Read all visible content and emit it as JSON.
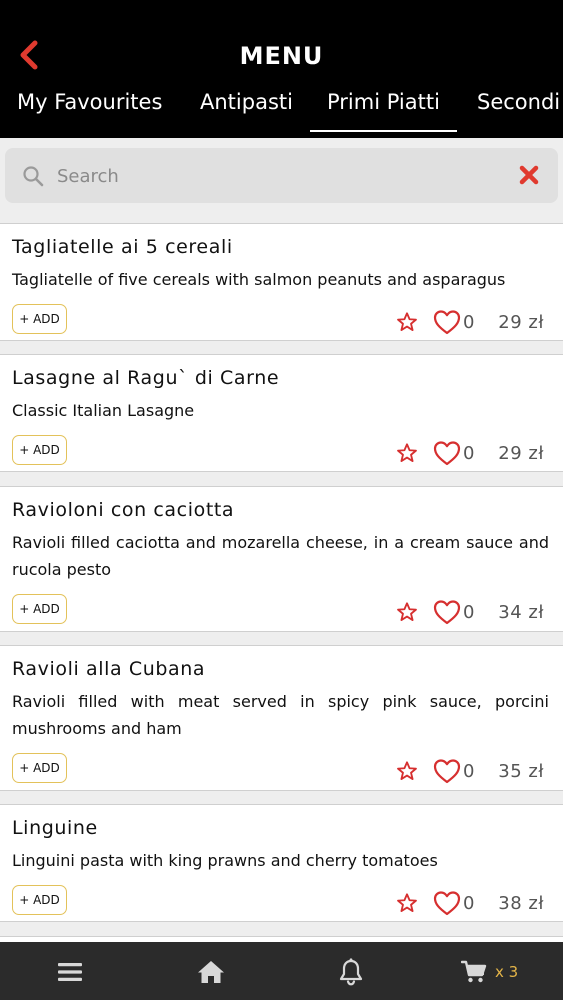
{
  "header": {
    "title": "MENU",
    "back_icon": "chevron-left-icon",
    "accent_color": "#e03a2f"
  },
  "tabs": [
    {
      "label": "My Favourites",
      "active": false
    },
    {
      "label": "Antipasti",
      "active": false
    },
    {
      "label": "Primi Piatti",
      "active": true
    },
    {
      "label": "Secondi",
      "active": false
    }
  ],
  "search": {
    "placeholder": "Search",
    "value": "",
    "icon": "search-icon",
    "clear_icon": "close-icon",
    "clear_color": "#e03a2f"
  },
  "items": [
    {
      "name": "Tagliatelle ai 5 cereali",
      "description": "Tagliatelle of five cereals with salmon peanuts and asparagus",
      "add_label": "+ ADD",
      "likes": "0",
      "price": "29 zł"
    },
    {
      "name": "Lasagne al Ragu` di Carne",
      "description": "Classic Italian Lasagne",
      "add_label": "+ ADD",
      "likes": "0",
      "price": "29 zł"
    },
    {
      "name": "Ravioloni con caciotta",
      "description": "Ravioli filled caciotta and mozarella cheese, in a cream sauce and rucola pesto",
      "add_label": "+ ADD",
      "likes": "0",
      "price": "34 zł"
    },
    {
      "name": "Ravioli alla Cubana",
      "description": "Ravioli filled with meat served in spicy pink sauce, porcini mushrooms and ham",
      "add_label": "+ ADD",
      "likes": "0",
      "price": "35 zł"
    },
    {
      "name": "Linguine",
      "description": "Linguini pasta with king prawns and cherry tomatoes",
      "add_label": "+ ADD",
      "likes": "0",
      "price": "38 zł"
    }
  ],
  "bottom_nav": {
    "menu_icon": "hamburger-icon",
    "home_icon": "home-icon",
    "bell_icon": "bell-icon",
    "cart_icon": "cart-icon",
    "cart_count": "x 3",
    "cart_count_color": "#e3b448"
  }
}
